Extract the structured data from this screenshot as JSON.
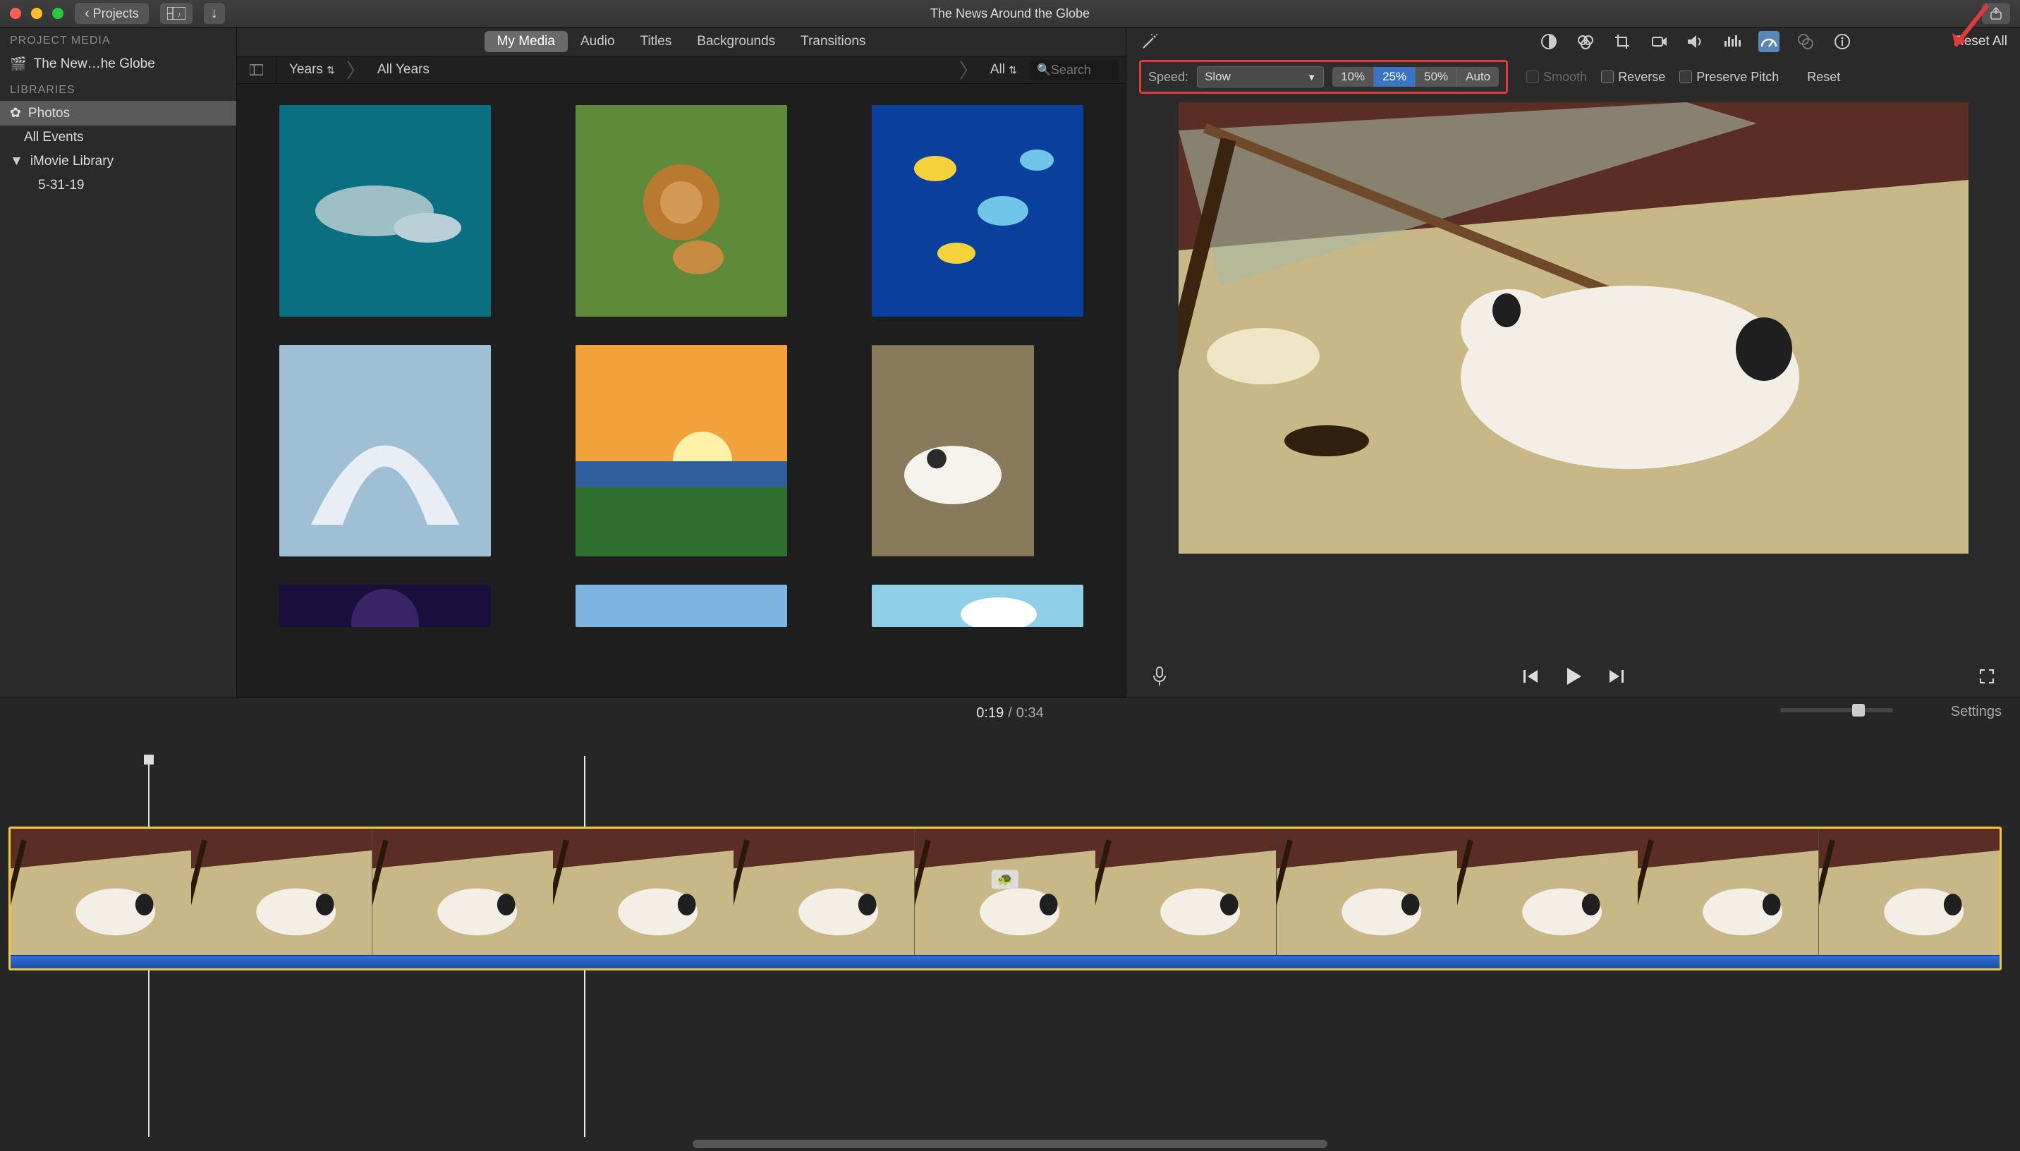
{
  "titlebar": {
    "projects_label": "Projects",
    "title": "The News Around the Globe"
  },
  "tabs": {
    "my_media": "My Media",
    "audio": "Audio",
    "titles": "Titles",
    "backgrounds": "Backgrounds",
    "transitions": "Transitions"
  },
  "breadcrumb": {
    "years": "Years",
    "all_years": "All Years",
    "all": "All",
    "search_placeholder": "Search"
  },
  "sidebar": {
    "project_media": "PROJECT MEDIA",
    "project_name": "The New…he Globe",
    "libraries": "LIBRARIES",
    "photos": "Photos",
    "all_events": "All Events",
    "imovie_library": "iMovie Library",
    "date_event": "5-31-19"
  },
  "media_thumbs": {
    "items": [
      {
        "name": "dolphins"
      },
      {
        "name": "lions"
      },
      {
        "name": "reef-fish"
      },
      {
        "name": "ice-arch"
      },
      {
        "name": "sunset-field"
      },
      {
        "name": "dog-on-bed"
      }
    ]
  },
  "tools": {
    "reset_all": "Reset All"
  },
  "speed": {
    "label": "Speed:",
    "select_value": "Slow",
    "pct_10": "10%",
    "pct_25": "25%",
    "pct_50": "50%",
    "pct_auto": "Auto",
    "smooth": "Smooth",
    "reverse": "Reverse",
    "preserve_pitch": "Preserve Pitch",
    "reset": "Reset"
  },
  "time": {
    "current": "0:19",
    "sep": "/",
    "total": "0:34"
  },
  "settings_label": "Settings",
  "turtle_icon": "🐢"
}
